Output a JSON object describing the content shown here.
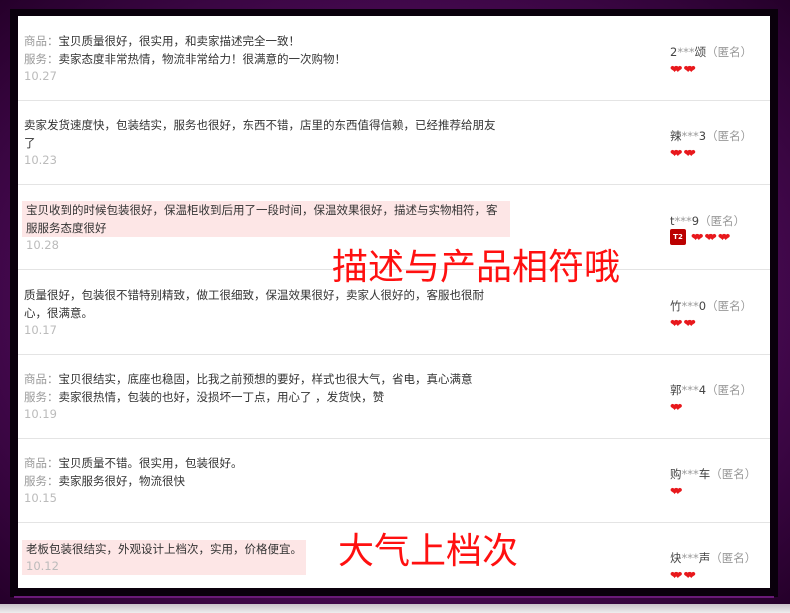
{
  "colors": {
    "frame": "#3a0044",
    "highlight": "#fde6e6",
    "heart": "#e8181c",
    "overlay_text": "#ff1010"
  },
  "reviews": [
    {
      "lines": [
        {
          "label": "商品：",
          "text": "宝贝质量很好，很实用，和卖家描述完全一致！"
        },
        {
          "label": "服务：",
          "text": "卖家态度非常热情，物流非常给力！很满意的一次购物！"
        }
      ],
      "date": "10.27",
      "user_first": "2",
      "user_mask": "***",
      "user_last": "颂",
      "anon": "（匿名）",
      "hearts": 2
    },
    {
      "lines": [
        {
          "label": "",
          "text": "卖家发货速度快，包装结实，服务也很好，东西不错，店里的东西值得信赖，已经推荐给朋友了"
        }
      ],
      "date": "10.23",
      "user_first": "辣",
      "user_mask": "***",
      "user_last": "3",
      "anon": "（匿名）",
      "hearts": 2
    },
    {
      "lines": [
        {
          "label": "",
          "text": "宝贝收到的时候包装很好，保温柜收到后用了一段时间，保温效果很好，描述与实物相符，客服服务态度很好"
        }
      ],
      "date": "10.28",
      "user_first": "t",
      "user_mask": "***",
      "user_last": "9",
      "anon": "（匿名）",
      "hearts": 3,
      "badge": "T2",
      "highlight": true
    },
    {
      "lines": [
        {
          "label": "",
          "text": "质量很好，包装很不错特别精致，做工很细致，保温效果很好，卖家人很好的，客服也很耐心，很满意。"
        }
      ],
      "date": "10.17",
      "user_first": "竹",
      "user_mask": "***",
      "user_last": "0",
      "anon": "（匿名）",
      "hearts": 2
    },
    {
      "lines": [
        {
          "label": "商品：",
          "text": "宝贝很结实，底座也稳固，比我之前预想的要好，样式也很大气，省电，真心满意"
        },
        {
          "label": "服务：",
          "text": "卖家很热情，包装的也好，没损坏一丁点，用心了 ，发货快，赞"
        }
      ],
      "date": "10.19",
      "user_first": "郭",
      "user_mask": "***",
      "user_last": "4",
      "anon": "（匿名）",
      "hearts": 1
    },
    {
      "lines": [
        {
          "label": "商品：",
          "text": "宝贝质量不错。很实用，包装很好。"
        },
        {
          "label": "服务：",
          "text": "卖家服务很好，物流很快"
        }
      ],
      "date": "10.15",
      "user_first": "购",
      "user_mask": "***",
      "user_last": "车",
      "anon": "（匿名）",
      "hearts": 1
    },
    {
      "lines": [
        {
          "label": "",
          "text": "老板包装很结实，外观设计上档次，实用，价格便宜。"
        }
      ],
      "date": "10.12",
      "user_first": "炔",
      "user_mask": "***",
      "user_last": "声",
      "anon": "（匿名）",
      "hearts": 2,
      "highlight": true
    }
  ],
  "overlays": [
    "描述与产品相符哦",
    "大气上档次"
  ]
}
